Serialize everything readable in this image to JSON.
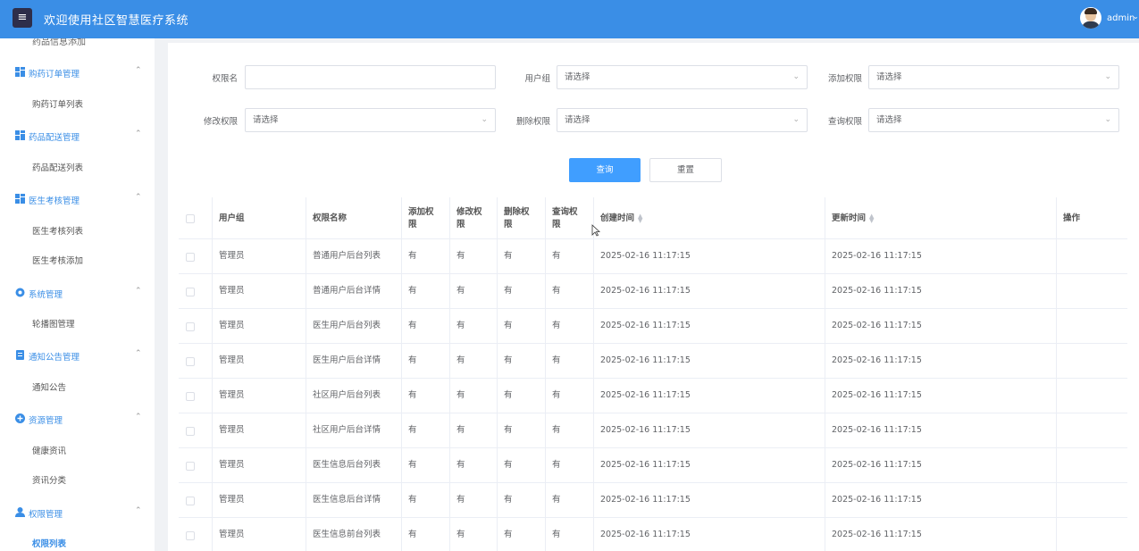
{
  "header": {
    "title": "欢迎使用社区智慧医疗系统",
    "user": "admin",
    "accent": "#3a8ee6"
  },
  "sidebar": {
    "cut_item": "药品信息添加",
    "groups": [
      {
        "label": "购药订单管理",
        "icon": "grid-icon",
        "items": [
          "购药订单列表"
        ]
      },
      {
        "label": "药品配送管理",
        "icon": "grid-icon",
        "items": [
          "药品配送列表"
        ]
      },
      {
        "label": "医生考核管理",
        "icon": "grid-icon",
        "items": [
          "医生考核列表",
          "医生考核添加"
        ]
      },
      {
        "label": "系统管理",
        "icon": "gear-icon",
        "items": [
          "轮播图管理"
        ]
      },
      {
        "label": "通知公告管理",
        "icon": "document-icon",
        "items": [
          "通知公告"
        ]
      },
      {
        "label": "资源管理",
        "icon": "plus-circle-icon",
        "items": [
          "健康资讯",
          "资讯分类"
        ]
      },
      {
        "label": "权限管理",
        "icon": "user-icon",
        "items": [
          "权限列表"
        ]
      }
    ]
  },
  "filters": {
    "perm_name_label": "权限名",
    "perm_name_value": "",
    "user_group_label": "用户组",
    "add_perm_label": "添加权限",
    "edit_perm_label": "修改权限",
    "delete_perm_label": "删除权限",
    "query_perm_label": "查询权限",
    "select_placeholder": "请选择",
    "query_button": "查询",
    "reset_button": "重置"
  },
  "table": {
    "headers": {
      "user_group": "用户组",
      "perm_name": "权限名称",
      "add_perm": "添加权限",
      "edit_perm": "修改权限",
      "delete_perm": "删除权限",
      "query_perm": "查询权限",
      "created": "创建时间",
      "updated": "更新时间",
      "actions": "操作"
    },
    "rows": [
      {
        "group": "管理员",
        "name": "普通用户后台列表",
        "add": "有",
        "edit": "有",
        "del": "有",
        "query": "有",
        "created": "2025-02-16 11:17:15",
        "updated": "2025-02-16 11:17:15"
      },
      {
        "group": "管理员",
        "name": "普通用户后台详情",
        "add": "有",
        "edit": "有",
        "del": "有",
        "query": "有",
        "created": "2025-02-16 11:17:15",
        "updated": "2025-02-16 11:17:15"
      },
      {
        "group": "管理员",
        "name": "医生用户后台列表",
        "add": "有",
        "edit": "有",
        "del": "有",
        "query": "有",
        "created": "2025-02-16 11:17:15",
        "updated": "2025-02-16 11:17:15"
      },
      {
        "group": "管理员",
        "name": "医生用户后台详情",
        "add": "有",
        "edit": "有",
        "del": "有",
        "query": "有",
        "created": "2025-02-16 11:17:15",
        "updated": "2025-02-16 11:17:15"
      },
      {
        "group": "管理员",
        "name": "社区用户后台列表",
        "add": "有",
        "edit": "有",
        "del": "有",
        "query": "有",
        "created": "2025-02-16 11:17:15",
        "updated": "2025-02-16 11:17:15"
      },
      {
        "group": "管理员",
        "name": "社区用户后台详情",
        "add": "有",
        "edit": "有",
        "del": "有",
        "query": "有",
        "created": "2025-02-16 11:17:15",
        "updated": "2025-02-16 11:17:15"
      },
      {
        "group": "管理员",
        "name": "医生信息后台列表",
        "add": "有",
        "edit": "有",
        "del": "有",
        "query": "有",
        "created": "2025-02-16 11:17:15",
        "updated": "2025-02-16 11:17:15"
      },
      {
        "group": "管理员",
        "name": "医生信息后台详情",
        "add": "有",
        "edit": "有",
        "del": "有",
        "query": "有",
        "created": "2025-02-16 11:17:15",
        "updated": "2025-02-16 11:17:15"
      },
      {
        "group": "管理员",
        "name": "医生信息前台列表",
        "add": "有",
        "edit": "有",
        "del": "有",
        "query": "有",
        "created": "2025-02-16 11:17:15",
        "updated": "2025-02-16 11:17:15"
      }
    ]
  }
}
